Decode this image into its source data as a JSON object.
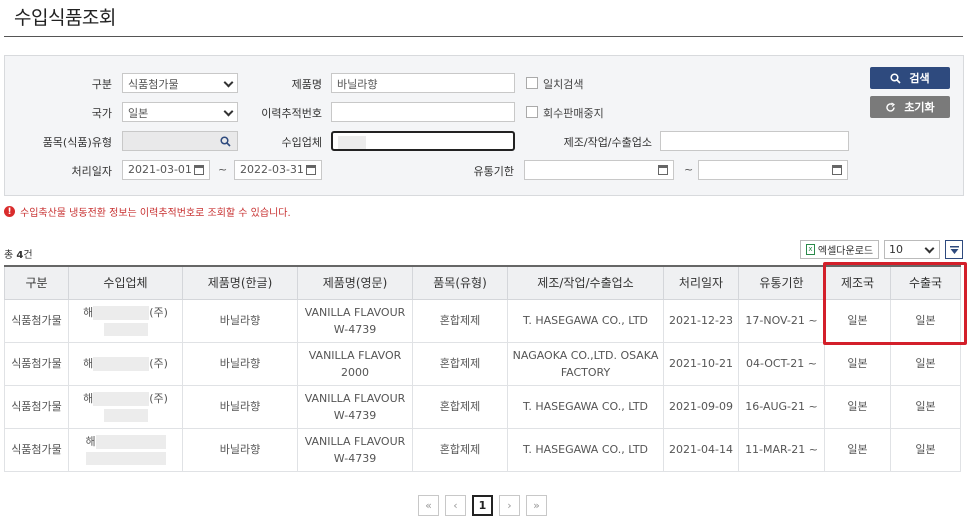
{
  "page": {
    "title": "수입식품조회"
  },
  "search": {
    "category_label": "구분",
    "category_value": "식품첨가물",
    "country_label": "국가",
    "country_value": "일본",
    "item_type_label": "품목(식품)유형",
    "item_type_value": "",
    "date_label": "처리일자",
    "date_from": "2021-03-01",
    "date_to": "2022-03-31",
    "tilde": "~",
    "product_label": "제품명",
    "product_value": "바닐라향",
    "trace_label": "이력추적번호",
    "trace_value": "",
    "importer_label": "수입업체",
    "importer_value": "",
    "expiry_label": "유통기한",
    "expiry_from": "",
    "expiry_to": "",
    "exact_match_label": "일치검색",
    "recall_label": "회수판매중지",
    "maker_label": "제조/작업/수출업소",
    "maker_value": "",
    "search_button": "검색",
    "reset_button": "초기화"
  },
  "notice": {
    "text": "수입축산물 냉동전환 정보는 이력추적번호로 조회할 수 있습니다.",
    "icon": "!"
  },
  "results": {
    "total_prefix": "총 ",
    "total_count": "4",
    "total_suffix": "건",
    "excel_label": "엑셀다운로드",
    "page_size": "10"
  },
  "table": {
    "headers": [
      "구분",
      "수입업체",
      "제품명(한글)",
      "제품명(영문)",
      "품목(유형)",
      "제조/작업/수출업소",
      "처리일자",
      "유통기한",
      "제조국",
      "수출국"
    ],
    "rows": [
      {
        "category": "식품첨가물",
        "importer_prefix": "해",
        "importer_suffix": "(주)",
        "name_ko": "바닐라향",
        "name_en": "VANILLA FLAVOUR W-4739",
        "type": "혼합제제",
        "maker": "T. HASEGAWA CO., LTD",
        "date": "2021-12-23",
        "expiry": "17-NOV-21 ~",
        "origin": "일본",
        "export": "일본"
      },
      {
        "category": "식품첨가물",
        "importer_prefix": "해",
        "importer_suffix": "(주)",
        "name_ko": "바닐라향",
        "name_en": "VANILLA FLAVOR 2000",
        "type": "혼합제제",
        "maker": "NAGAOKA CO.,LTD. OSAKA FACTORY",
        "date": "2021-10-21",
        "expiry": "04-OCT-21 ~",
        "origin": "일본",
        "export": "일본"
      },
      {
        "category": "식품첨가물",
        "importer_prefix": "해",
        "importer_suffix": "(주)",
        "name_ko": "바닐라향",
        "name_en": "VANILLA FLAVOUR W-4739",
        "type": "혼합제제",
        "maker": "T. HASEGAWA CO., LTD",
        "date": "2021-09-09",
        "expiry": "16-AUG-21 ~",
        "origin": "일본",
        "export": "일본"
      },
      {
        "category": "식품첨가물",
        "importer_prefix": "해",
        "importer_suffix": "",
        "name_ko": "바닐라향",
        "name_en": "VANILLA FLAVOUR W-4739",
        "type": "혼합제제",
        "maker": "T. HASEGAWA CO., LTD",
        "date": "2021-04-14",
        "expiry": "11-MAR-21 ~",
        "origin": "일본",
        "export": "일본"
      }
    ]
  },
  "pager": {
    "first": "«",
    "prev": "‹",
    "current": "1",
    "next": "›",
    "last": "»"
  },
  "colors": {
    "primary": "#2e4a7e",
    "reset": "#7a7a7a",
    "highlight": "#d31f2a",
    "notice": "#c83232"
  }
}
